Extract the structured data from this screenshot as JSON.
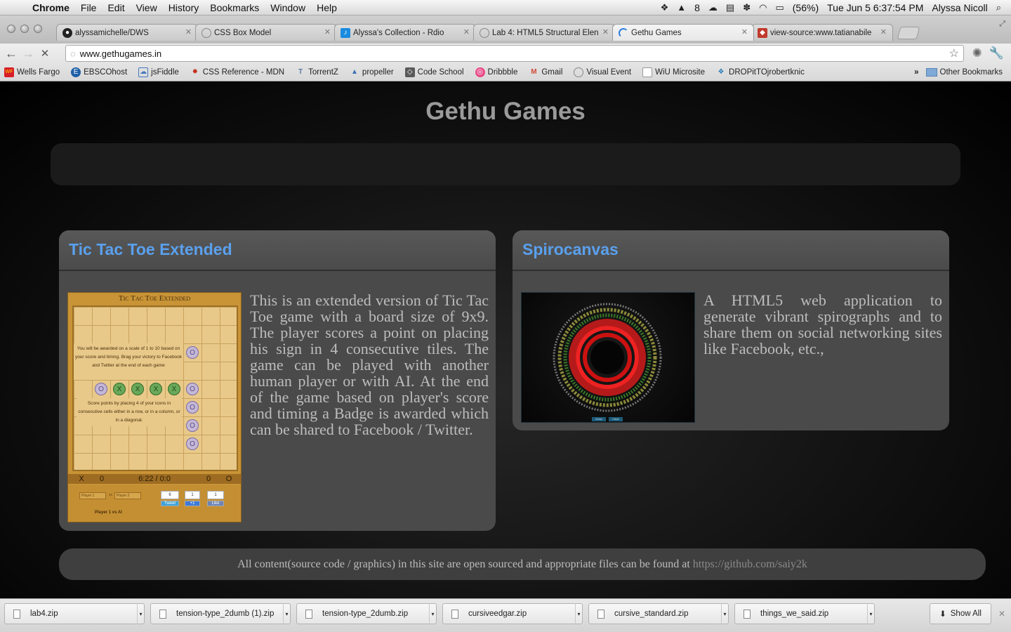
{
  "menubar": {
    "app": "Chrome",
    "items": [
      "File",
      "Edit",
      "View",
      "History",
      "Bookmarks",
      "Window",
      "Help"
    ],
    "status_count": "8",
    "battery": "(56%)",
    "datetime": "Tue Jun 5  6:37:54 PM",
    "user": "Alyssa Nicoll"
  },
  "tabs": [
    {
      "title": "alyssamichelle/DWS",
      "icon": "github-icon",
      "active": false
    },
    {
      "title": "CSS Box Model",
      "icon": "globe-icon",
      "active": false
    },
    {
      "title": "Alyssa's Collection - Rdio",
      "icon": "rdio-icon",
      "active": false
    },
    {
      "title": "Lab 4: HTML5 Structural Elen",
      "icon": "globe-icon",
      "active": false
    },
    {
      "title": "Gethu Games",
      "icon": "loading-icon",
      "active": true
    },
    {
      "title": "view-source:www.tatianabile",
      "icon": "source-icon",
      "active": false
    }
  ],
  "toolbar": {
    "url": "www.gethugames.in"
  },
  "bookmarks": [
    {
      "label": "Wells Fargo",
      "icon": "wellsfargo-icon",
      "color": "#d71e28"
    },
    {
      "label": "EBSCOhost",
      "icon": "ebsco-icon",
      "color": "#1f5fa8"
    },
    {
      "label": "jsFiddle",
      "icon": "jsfiddle-icon",
      "color": "#4679bd"
    },
    {
      "label": "CSS Reference - MDN",
      "icon": "mdn-icon",
      "color": "#c32d1c"
    },
    {
      "label": "TorrentZ",
      "icon": "torrentz-icon",
      "color": "#5a7aa5"
    },
    {
      "label": "propeller",
      "icon": "propeller-icon",
      "color": "#3a6fb5"
    },
    {
      "label": "Code School",
      "icon": "codeschool-icon",
      "color": "#5a5a5a"
    },
    {
      "label": "Dribbble",
      "icon": "dribbble-icon",
      "color": "#ea4c89"
    },
    {
      "label": "Gmail",
      "icon": "gmail-icon",
      "color": "#d14836"
    },
    {
      "label": "Visual Event",
      "icon": "globe-icon",
      "color": "#888888"
    },
    {
      "label": "WiU Microsite",
      "icon": "page-icon",
      "color": "#888888"
    },
    {
      "label": "DROPitTOjrobertknic",
      "icon": "dropbox-icon",
      "color": "#2b7bb9"
    }
  ],
  "bookmarks_more": "»",
  "other_bookmarks": "Other Bookmarks",
  "page": {
    "title": "Gethu Games",
    "games": [
      {
        "title": "Tic Tac Toe Extended",
        "description": "This is an extended version of Tic Tac Toe game with a board size of 9x9. The player scores a point on placing his sign in 4 consecutive tiles. The game can be played with another human player or with AI. At the end of the game based on player's score and timing a Badge is awarded which can be shared to Facebook / Twitter."
      },
      {
        "title": "Spirocanvas",
        "description": "A HTML5 web application to generate vibrant spirographs and to share them on social networking sites like Facebook, etc.,"
      }
    ],
    "footer_text": "All content(source code / graphics) in this site are open sourced and appropriate files can be found at",
    "footer_link": "https://github.com/saiy2k"
  },
  "ttt_thumb": {
    "heading": "Tic Tac Toe Extended",
    "note1": "You will be awarded on a scale of 1 to 10 based on your score and timing. Brag your victory to Facebook and Twitter at the end of each game",
    "note2": "Score points by placing 4 of your icons in consecutive cells either in a row, or in a column, or in a diagonal.",
    "score_x_label": "X",
    "score_x": "0",
    "timer": "6:22 / 0:0",
    "score_o": "0",
    "score_o_label": "O",
    "player1": "Player 1",
    "vs": "vs",
    "player2": "Player 2",
    "player_line": "Player 1 vs AI",
    "count_tweet": "6",
    "count_plus": "1",
    "count_like": "1",
    "btn_tweet": "Tweet",
    "btn_plus": "+1",
    "btn_like": "Like"
  },
  "spiro_thumb": {
    "btn_draw": "Draw",
    "btn_clear": "Clear"
  },
  "downloads": [
    {
      "name": "lab4.zip"
    },
    {
      "name": "tension-type_2dumb (1).zip"
    },
    {
      "name": "tension-type_2dumb.zip"
    },
    {
      "name": "cursiveedgar.zip"
    },
    {
      "name": "cursive_standard.zip"
    },
    {
      "name": "things_we_said.zip"
    }
  ],
  "show_all": "Show All"
}
